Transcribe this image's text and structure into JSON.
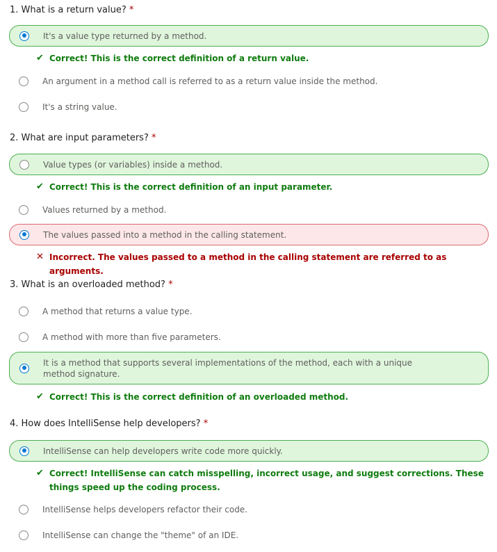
{
  "quiz": {
    "questions": [
      {
        "title": "1. What is a return value?",
        "options": [
          "It's a value type returned by a method.",
          "An argument in a method call is referred to as a return value inside the method.",
          "It's a string value."
        ],
        "feedback": [
          {
            "text": "Correct! This is the correct definition of a return value.",
            "icon": "check-icon"
          }
        ]
      },
      {
        "title": "2. What are input parameters?",
        "options": [
          "Value types (or variables) inside a method.",
          "Values returned by a method.",
          "The values passed into a method in the calling statement."
        ],
        "feedback": [
          {
            "text": "Correct! This is the correct definition of an input parameter.",
            "icon": "check-icon"
          },
          {
            "text": "Incorrect. The values passed to a method in the calling statement are referred to as arguments.",
            "icon": "x-icon"
          }
        ]
      },
      {
        "title": "3. What is an overloaded method?",
        "options": [
          "A method that returns a value type.",
          "A method with more than five parameters.",
          "It is a method that supports several implementations of the method, each with a unique method signature."
        ],
        "feedback": [
          {
            "text": "Correct! This is the correct definition of an overloaded method.",
            "icon": "check-icon"
          }
        ]
      },
      {
        "title": "4. How does IntelliSense help developers?",
        "options": [
          "IntelliSense can help developers write code more quickly.",
          "IntelliSense helps developers refactor their code.",
          "IntelliSense can change the \"theme\" of an IDE."
        ],
        "feedback": [
          {
            "text": "Correct! IntelliSense can catch misspelling, incorrect usage, and suggest corrections. These things speed up the coding process.",
            "icon": "check-icon"
          }
        ]
      }
    ],
    "required_marker": "*",
    "check_glyph": "✔",
    "cross_glyph": "✕",
    "colors": {
      "correct_bg": "#dff6dd",
      "correct_border": "#4caf50",
      "incorrect_bg": "#fde7e9",
      "incorrect_border": "#d96a72",
      "correct_text": "#107c10",
      "incorrect_text": "#a80000",
      "radio_selected": "#0078d4"
    }
  }
}
